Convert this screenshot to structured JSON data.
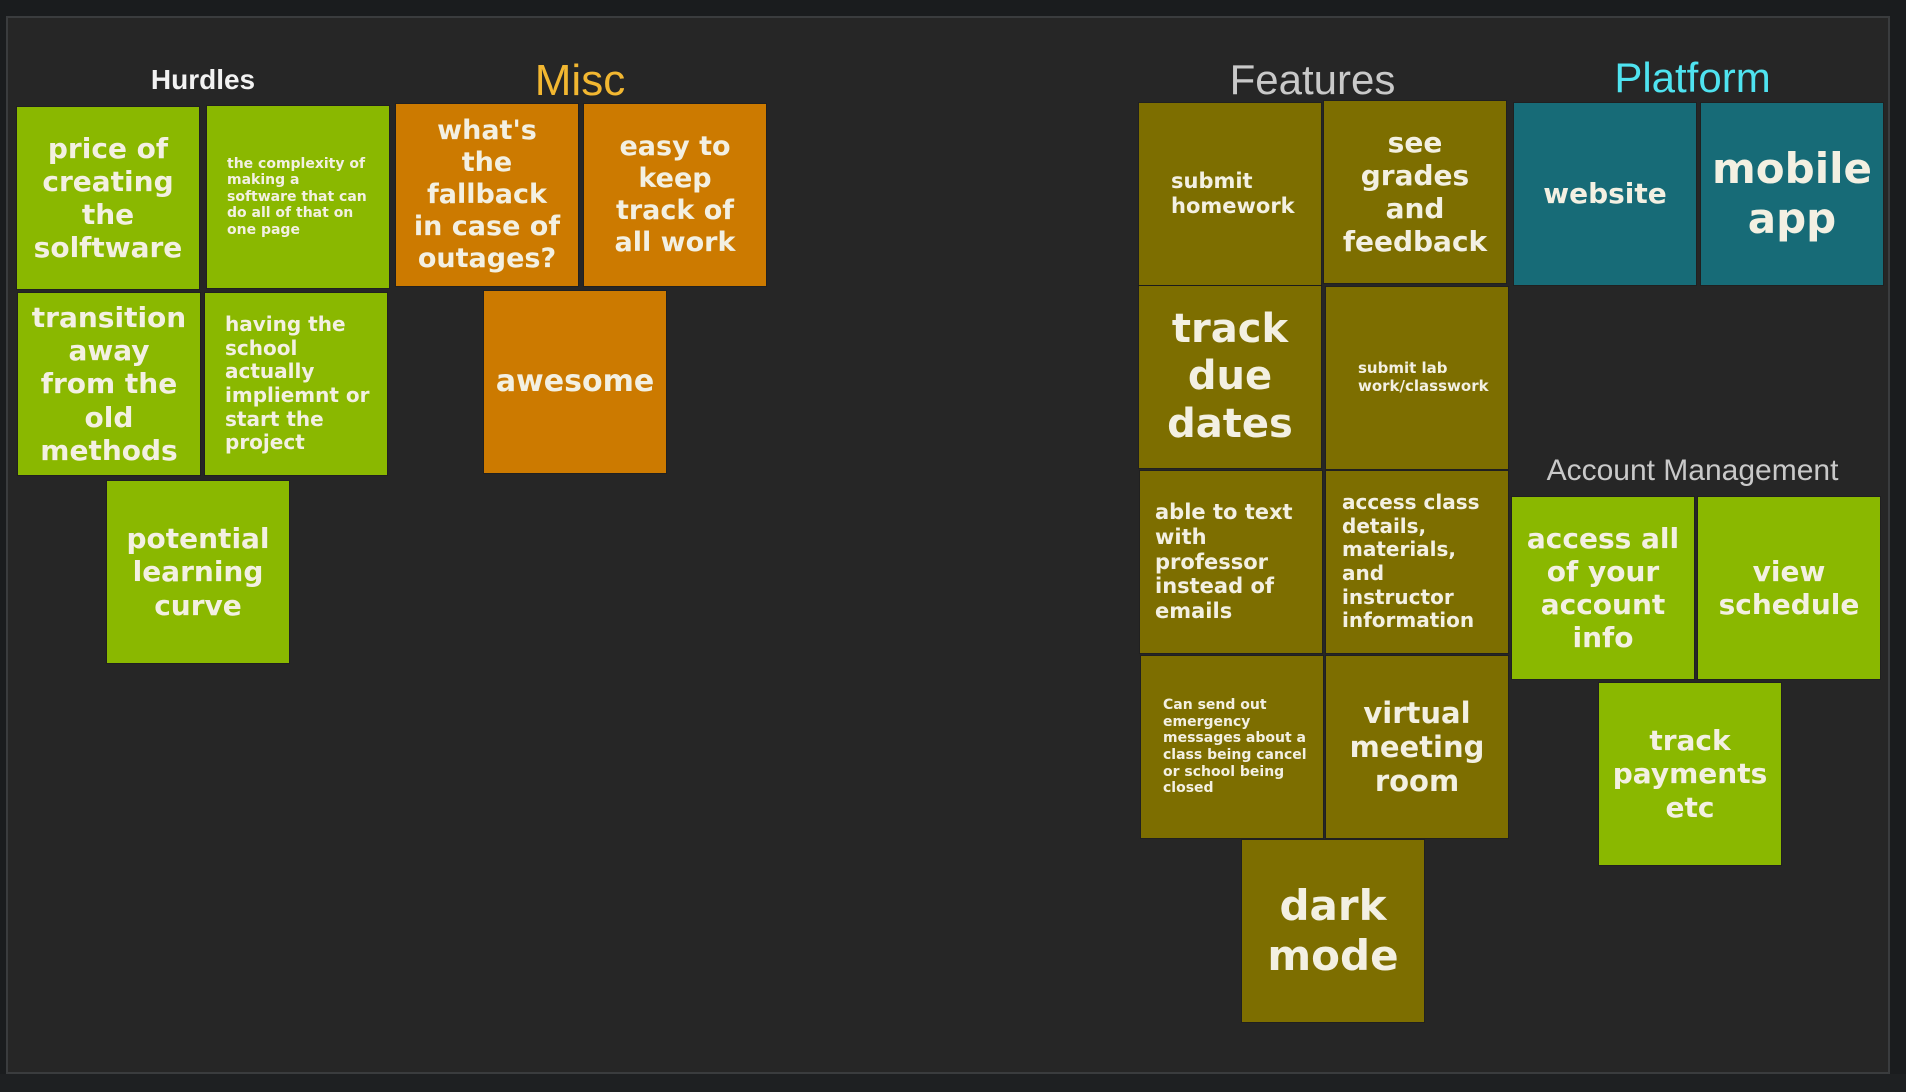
{
  "colors": {
    "board_bg": "#262626",
    "green_note": "#8ab800",
    "orange_note": "#cc7a00",
    "olive_note": "#7d6e00",
    "teal_note": "#176b77",
    "misc_title": "#f2b731",
    "platform_title": "#4fe3f0",
    "features_title": "#c9c9c9"
  },
  "sections": {
    "hurdles": "Hurdles",
    "misc": "Misc",
    "features": "Features",
    "platform": "Platform",
    "account_management": "Account Management"
  },
  "notes": {
    "price_software": "price of creating the solftware",
    "complexity": "the complexity of making a software that can do all of that on one page",
    "transition": "transition away from the old methods",
    "school_implement": "having the school actually impliemnt or start the project",
    "learning_curve": "potential learning curve",
    "fallback": "what's the fallback in case of outages?",
    "easy_track": "easy to keep track of all work",
    "awesome": "awesome",
    "submit_homework": "submit homework",
    "see_grades": "see grades and feedback",
    "track_due_dates": "track due dates",
    "submit_lab": "submit lab work/classwork",
    "text_professor": "able to text with professor instead of emails",
    "access_class": "access class details, materials, and instructor information",
    "emergency": "Can send out emergency messages about a class being cancel or school being closed",
    "virtual_meeting": "virtual meeting room",
    "dark_mode": "dark mode",
    "website": "website",
    "mobile_app": "mobile app",
    "access_account": "access all of your account info",
    "view_schedule": "view schedule",
    "track_payments": "track payments etc"
  }
}
